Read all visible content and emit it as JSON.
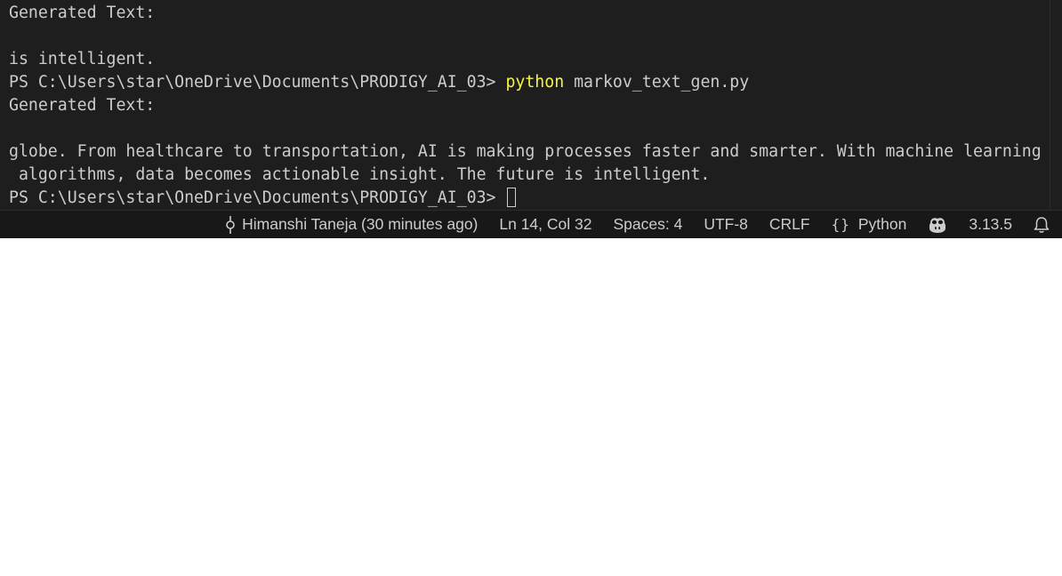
{
  "terminal": {
    "lines": [
      "Generated Text:",
      "",
      "is intelligent.",
      "PS C:\\Users\\star\\OneDrive\\Documents\\PRODIGY_AI_03> ",
      "Generated Text:",
      "",
      "globe. From healthcare to transportation, AI is making processes faster and smarter. With machine learning",
      " algorithms, data becomes actionable insight. The future is intelligent.",
      "PS C:\\Users\\star\\OneDrive\\Documents\\PRODIGY_AI_03> "
    ],
    "command_name": "python",
    "command_args": " markov_text_gen.py",
    "colors": {
      "background": "#1e1e1e",
      "foreground": "#cccccc",
      "command": "#f5f543"
    }
  },
  "statusbar": {
    "git_blame": "Himanshi Taneja (30 minutes ago)",
    "git_icon": "git-commit-icon",
    "cursor_position": "Ln 14, Col 32",
    "indentation": "Spaces: 4",
    "encoding": "UTF-8",
    "line_ending": "CRLF",
    "language": "Python",
    "language_icon": "braces-icon",
    "copilot_icon": "copilot-icon",
    "python_version": "3.13.5",
    "notification_icon": "bell-icon",
    "colors": {
      "background": "#181818",
      "foreground": "#cccccc"
    }
  }
}
